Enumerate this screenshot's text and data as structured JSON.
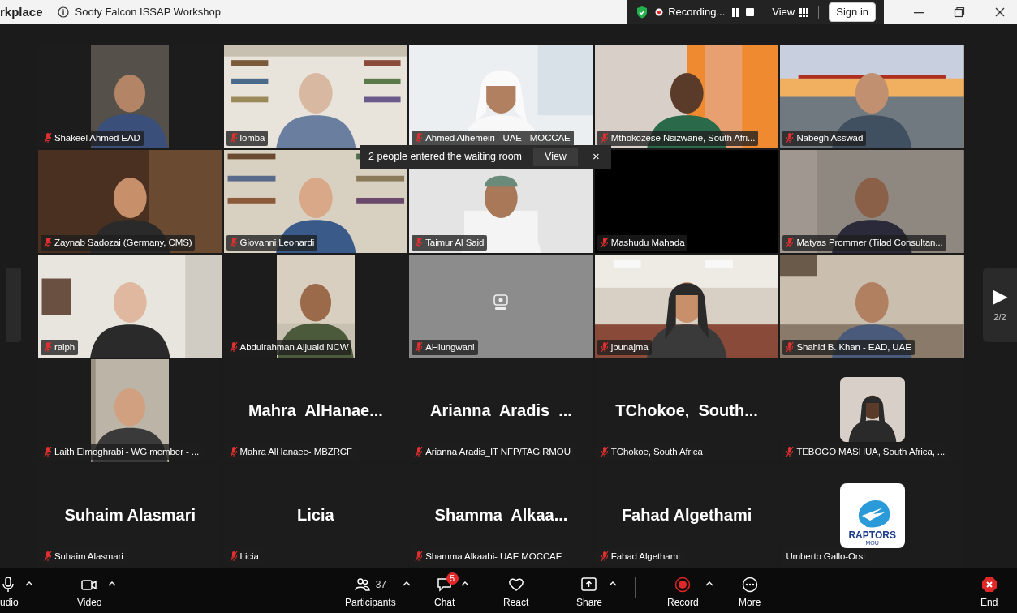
{
  "window": {
    "app_name": "rkplace",
    "title": "Sooty Falcon ISSAP Workshop",
    "recording_label": "Recording...",
    "view_label": "View",
    "sign_in": "Sign in"
  },
  "tiles": [
    {
      "kind": "video",
      "name": "Shakeel Ahmed EAD",
      "muted": true,
      "narrow": true
    },
    {
      "kind": "video",
      "name": "lomba",
      "muted": true,
      "narrow": false
    },
    {
      "kind": "video",
      "name": "Ahmed Alhemeiri - UAE - MOCCAE",
      "muted": true,
      "narrow": false
    },
    {
      "kind": "video",
      "name": "Mthokozese Nsizwane, South Afri...",
      "muted": true,
      "narrow": false
    },
    {
      "kind": "video",
      "name": "Nabegh Asswad",
      "muted": true,
      "narrow": false
    },
    {
      "kind": "video",
      "name": "Zaynab Sadozai (Germany, CMS)",
      "muted": true,
      "narrow": false
    },
    {
      "kind": "video",
      "name": "Giovanni Leonardi",
      "muted": true,
      "narrow": false
    },
    {
      "kind": "video",
      "name": "Taimur Al Said",
      "muted": true,
      "narrow": false
    },
    {
      "kind": "camera_off",
      "name": "Mashudu Mahada",
      "muted": true
    },
    {
      "kind": "video",
      "name": "Matyas Prommer (Tilad Consultan...",
      "muted": true,
      "narrow": false
    },
    {
      "kind": "video",
      "name": "ralph",
      "muted": true,
      "narrow": false
    },
    {
      "kind": "video",
      "name": "Abdulrahman Aljuaid NCW",
      "muted": true,
      "narrow": true
    },
    {
      "kind": "placeholder",
      "name": "AHlungwani",
      "muted": true
    },
    {
      "kind": "video",
      "name": "jbunajma",
      "muted": true,
      "narrow": false
    },
    {
      "kind": "video",
      "name": "Shahid B. Khan - EAD, UAE",
      "muted": true,
      "narrow": false
    },
    {
      "kind": "video",
      "name": "Laith Elmoghrabi - WG member - ...",
      "muted": true,
      "narrow": true
    },
    {
      "kind": "name",
      "display": "Mahra  AlHanae...",
      "name": "Mahra AlHanaee- MBZRCF",
      "muted": true
    },
    {
      "kind": "name",
      "display": "Arianna  Aradis_...",
      "name": "Arianna Aradis_IT NFP/TAG RMOU",
      "muted": true
    },
    {
      "kind": "name",
      "display": "TChokoe,  South...",
      "name": "TChokoe, South Africa",
      "muted": true
    },
    {
      "kind": "avatar",
      "name": "TEBOGO MASHUA, South Africa, ...",
      "muted": true
    },
    {
      "kind": "name",
      "display": "Suhaim Alasmari",
      "name": "Suhaim Alasmari",
      "muted": true
    },
    {
      "kind": "name",
      "display": "Licia",
      "name": "Licia",
      "muted": true
    },
    {
      "kind": "name",
      "display": "Shamma  Alkaa...",
      "name": "Shamma Alkaabi- UAE MOCCAE",
      "muted": true
    },
    {
      "kind": "name",
      "display": "Fahad Algethami",
      "name": "Fahad Algethami",
      "muted": true
    },
    {
      "kind": "logo",
      "logo_text": "RAPTORS",
      "logo_subtext": "MOU",
      "name": "Umberto Gallo-Orsi",
      "muted": false
    }
  ],
  "notification": {
    "text": "2 people entered the waiting room",
    "action": "View",
    "close": "×"
  },
  "pager": {
    "next": "▶",
    "page": "2/2"
  },
  "toolbar": [
    {
      "kind": "audio",
      "label": "udio",
      "caret": true
    },
    {
      "kind": "video",
      "label": "Video",
      "caret": true
    },
    {
      "kind": "participants",
      "label": "Participants",
      "count": "37",
      "caret": true
    },
    {
      "kind": "chat",
      "label": "Chat",
      "badge": "5",
      "caret": true
    },
    {
      "kind": "react",
      "label": "React",
      "caret": false
    },
    {
      "kind": "share",
      "label": "Share",
      "caret": true
    },
    {
      "kind": "record",
      "label": "Record",
      "caret": true
    },
    {
      "kind": "more",
      "label": "More",
      "caret": false
    },
    {
      "kind": "end",
      "label": "End",
      "caret": false
    }
  ]
}
